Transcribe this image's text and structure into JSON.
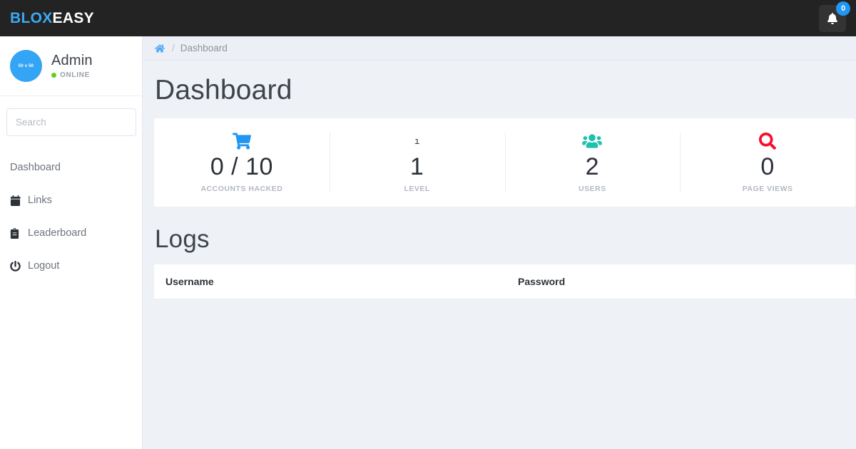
{
  "brand": {
    "part1": "BLOX",
    "part2": "EASY"
  },
  "topbar": {
    "notifications_icon": "bell-icon",
    "notifications_count": "0"
  },
  "sidebar": {
    "profile": {
      "avatar_placeholder": "50 x 50",
      "name": "Admin",
      "status": "ONLINE"
    },
    "search": {
      "placeholder": "Search",
      "value": ""
    },
    "items": [
      {
        "label": "Dashboard",
        "icon": ""
      },
      {
        "label": "Links",
        "icon": "calendar-icon"
      },
      {
        "label": "Leaderboard",
        "icon": "clipboard-icon"
      },
      {
        "label": "Logout",
        "icon": "power-icon"
      }
    ]
  },
  "breadcrumb": {
    "home_icon": "home-icon",
    "separator": "/",
    "current": "Dashboard"
  },
  "main": {
    "page_title": "Dashboard",
    "stats": [
      {
        "icon": "shopping-cart-icon",
        "icon_color": "#2196f3",
        "value": "0 / 10",
        "label": "ACCOUNTS HACKED"
      },
      {
        "icon": "missing-glyph-icon",
        "icon_color": "#2c3138",
        "value": "1",
        "label": "LEVEL",
        "glyph": "ı"
      },
      {
        "icon": "users-icon",
        "icon_color": "#1fc0ae",
        "value": "2",
        "label": "USERS"
      },
      {
        "icon": "search-magnifier-icon",
        "icon_color": "#f50f2e",
        "value": "0",
        "label": "PAGE VIEWS"
      }
    ],
    "logs": {
      "title": "Logs",
      "columns": [
        "Username",
        "Password"
      ],
      "rows": []
    }
  },
  "colors": {
    "topbar_bg": "#232323",
    "brand_blue": "#3ba9f4",
    "page_bg": "#eef1f5",
    "accent_blue": "#2196f3",
    "online_green": "#63d017",
    "users_teal": "#1fc0ae",
    "search_red": "#f50f2e"
  }
}
